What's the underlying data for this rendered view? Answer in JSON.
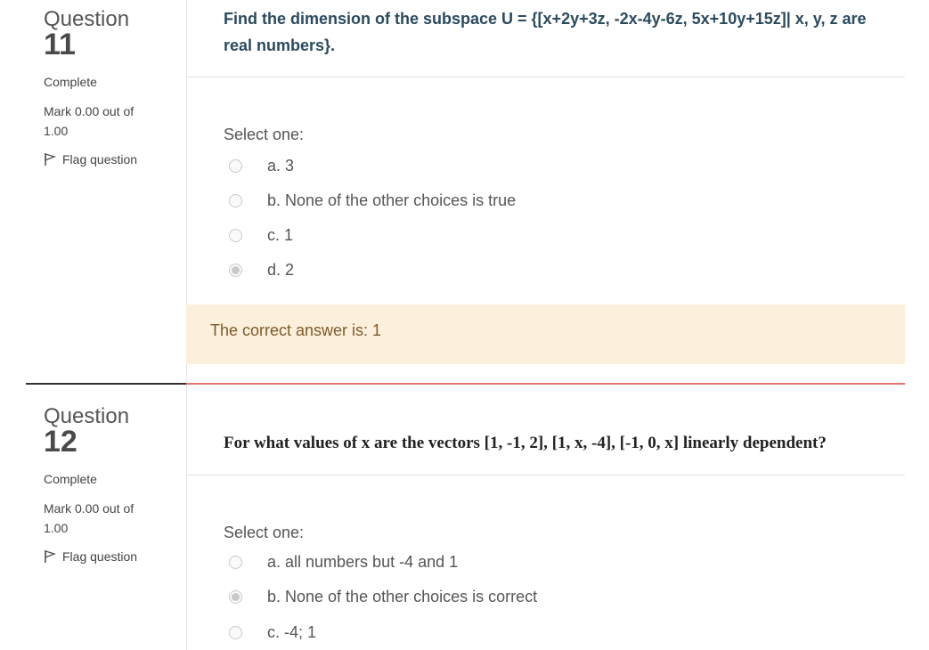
{
  "questions": [
    {
      "word": "Question",
      "number": "11",
      "state": "Complete",
      "mark": "Mark 0.00 out of 1.00",
      "flag": "Flag question",
      "text": "Find the dimension of the subspace U = {[x+2y+3z, -2x-4y-6z, 5x+10y+15z]| x, y, z are real numbers}.",
      "select_label": "Select one:",
      "options": [
        {
          "label": "a. 3",
          "checked": false
        },
        {
          "label": "b. None of the other choices is true",
          "checked": false
        },
        {
          "label": "c. 1",
          "checked": false
        },
        {
          "label": "d. 2",
          "checked": true
        }
      ],
      "feedback": "The correct answer is: 1"
    },
    {
      "word": "Question",
      "number": "12",
      "state": "Complete",
      "mark": "Mark 0.00 out of 1.00",
      "flag": "Flag question",
      "text": "For what values of x are the vectors [1, -1, 2], [1, x, -4], [-1, 0, x] linearly dependent?",
      "select_label": "Select one:",
      "options": [
        {
          "label": "a. all numbers but -4 and 1",
          "checked": false
        },
        {
          "label": "b. None of the other choices is correct",
          "checked": true
        },
        {
          "label": "c. -4; 1",
          "checked": false
        }
      ]
    }
  ],
  "colors": {
    "question_text": "#2b4a5e",
    "feedback_bg": "#fcefdc",
    "feedback_text": "#7d5b2a",
    "divider_accent": "#e57373"
  }
}
